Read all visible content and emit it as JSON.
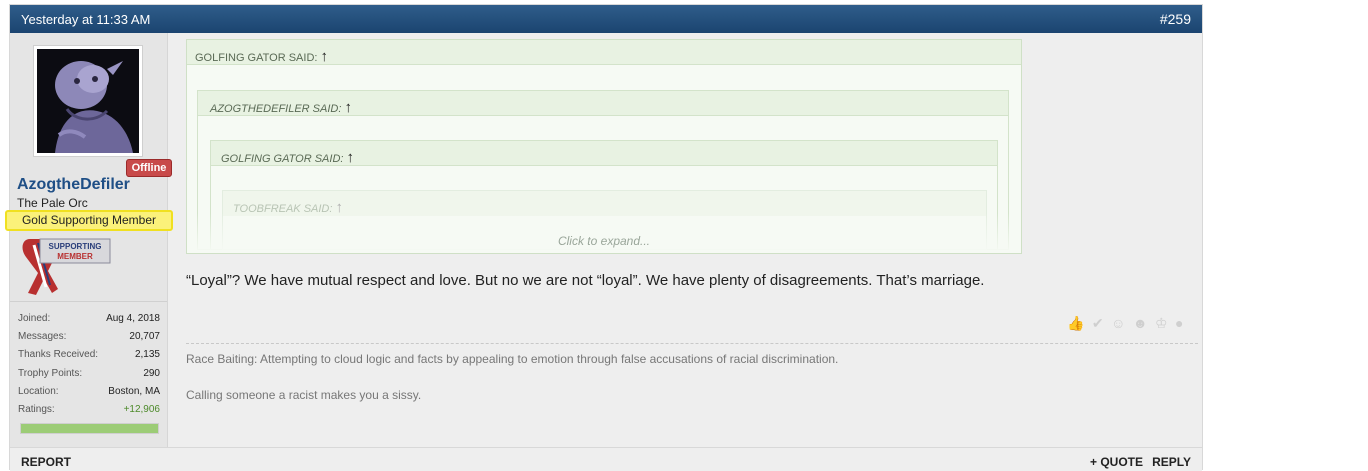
{
  "post": {
    "date": "Yesterday at 11:33 AM",
    "number": "#259"
  },
  "user": {
    "status_badge": "Offline",
    "username": "AzogtheDefiler",
    "title": "The Pale Orc",
    "banner": "Gold Supporting Member",
    "badge_text": [
      "SUPPORTING",
      "MEMBER"
    ],
    "stats": [
      {
        "label": "Joined:",
        "value": "Aug 4, 2018"
      },
      {
        "label": "Messages:",
        "value": "20,707"
      },
      {
        "label": "Thanks Received:",
        "value": "2,135"
      },
      {
        "label": "Trophy Points:",
        "value": "290"
      },
      {
        "label": "Location:",
        "value": "Boston, MA"
      },
      {
        "label": "Ratings:",
        "value": "+12,906"
      }
    ]
  },
  "quotes": {
    "level1": {
      "author": "GOLFING GATOR SAID:",
      "arrow": "↑"
    },
    "level2": {
      "author": "AZOGTHEDEFILER SAID:",
      "arrow": "↑"
    },
    "level3": {
      "author": "GOLFING GATOR SAID:",
      "arrow": "↑"
    },
    "level4": {
      "author": "TOOBFREAK SAID:",
      "arrow": "↑"
    },
    "expand_label": "Click to expand..."
  },
  "message": "“Loyal”? We have mutual respect and love. But no we are not “loyal”. We have plenty of disagreements. That’s marriage.",
  "signature": {
    "line1": "Race Baiting: Attempting to cloud logic and facts by appealing to emotion through false accusations of racial discrimination.",
    "line2": "Calling someone a racist makes you a sissy."
  },
  "footer": {
    "report": "REPORT",
    "quote": "+ QUOTE",
    "reply": "REPLY"
  },
  "colors": {
    "header": "#1b4470",
    "username": "#1f4f86",
    "offline": "#c84a4a",
    "banner": "#fbf17a",
    "ratings_positive": "#4d8a2a"
  }
}
